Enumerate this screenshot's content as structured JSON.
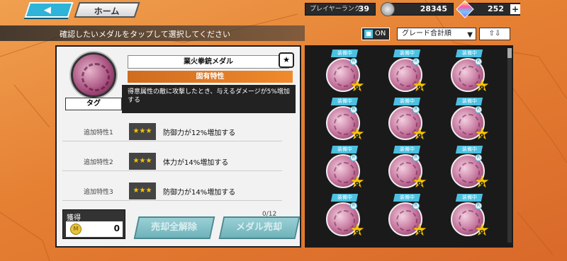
{
  "topbar": {
    "back_label": "◀",
    "home_label": "ホーム",
    "rank_label": "プレイヤーランク",
    "rank_value": "39",
    "coins_value": "28345",
    "gems_value": "252",
    "plus_label": "+"
  },
  "subbar": {
    "instruction": "確認したいメダルをタップして選択してください",
    "toggle_label": "ON",
    "grade_label": "グレード合計順",
    "sort_label": "⇧⇩"
  },
  "detail": {
    "medal_name": "業火拳銃メダル",
    "pin_label": "★",
    "unique_trait_title": "固有特性",
    "unique_trait_desc": "得意属性の敵に攻撃したとき、与えるダメージが5%増加する",
    "tag_label": "タグ",
    "traits": [
      {
        "label": "追加特性1",
        "stars": "★★★",
        "text": "防御力が12%増加する"
      },
      {
        "label": "追加特性2",
        "stars": "★★★",
        "text": "体力が14%増加する"
      },
      {
        "label": "追加特性3",
        "stars": "★★★",
        "text": "防御力が14%増加する"
      }
    ],
    "gain_label": "獲得",
    "gain_coin_letter": "M",
    "gain_value": "0",
    "counter": "0/12",
    "unequip_all_label": "売却全解除",
    "sell_label": "メダル売却"
  },
  "grid": {
    "equipped_label": "装備中",
    "r_label": "R",
    "level": "9",
    "cells": 12
  },
  "colors": {
    "accent_blue": "#4dbfe0",
    "orange": "#e88a3c",
    "star_gold": "#f7c400"
  }
}
